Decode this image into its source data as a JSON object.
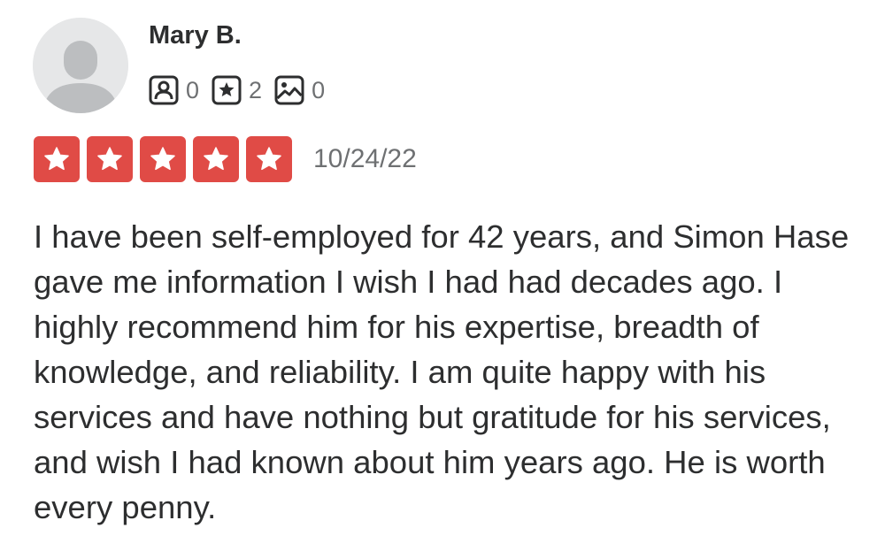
{
  "review": {
    "user_name": "Mary B.",
    "stats": {
      "friends_count": "0",
      "reviews_count": "2",
      "photos_count": "0"
    },
    "rating": 5,
    "date": "10/24/22",
    "text": "I have been self-employed for 42 years, and Simon Hase gave me information I wish I had had decades ago. I highly recommend him for his expertise, breadth of knowledge, and reliability. I am quite happy with his services and have nothing but gratitude for his services, and wish I had known about him years ago. He is worth every penny."
  },
  "icons": {
    "avatar": "default-user-avatar-icon",
    "friends": "friends-icon",
    "reviews": "star-review-icon",
    "photos": "photo-icon",
    "rating_star": "star-icon"
  },
  "colors": {
    "star_fill": "#e04b46",
    "text": "#2d2e2f",
    "secondary_text": "#6e7072",
    "avatar_bg": "#e6e7e8",
    "avatar_figure": "#bcbec0"
  }
}
